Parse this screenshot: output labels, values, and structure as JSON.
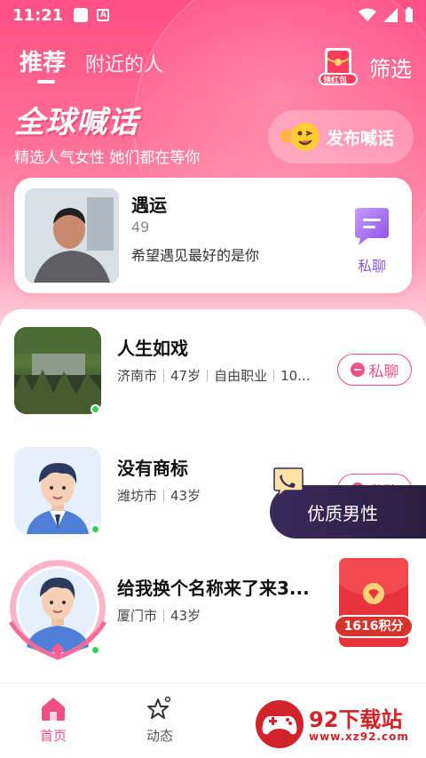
{
  "status_bar": {
    "time": "11:21",
    "app_badge": "A"
  },
  "tabs": [
    {
      "label": "推荐",
      "active": true
    },
    {
      "label": "附近的人",
      "active": false
    }
  ],
  "header": {
    "redpack_label": "领红包",
    "filter_label": "筛选",
    "title": "全球喊话",
    "subtitle": "精选人气女性 她们都在等你",
    "publish_label": "发布喊话"
  },
  "featured": {
    "name": "遇运",
    "age": "49",
    "message": "希望遇见最好的是你",
    "chat_label": "私聊"
  },
  "users": [
    {
      "name": "人生如戏",
      "city": "济南市",
      "age": "47岁",
      "job": "自由职业",
      "extra": "10...",
      "chat_label": "私聊"
    },
    {
      "name": "没有商标",
      "city": "潍坊市",
      "age": "43岁",
      "chat_label": "私聊"
    },
    {
      "name": "给我换个名称来了来3...",
      "city": "厦门市",
      "age": "43岁"
    }
  ],
  "quality_banner": "优质男性",
  "bonus": {
    "label": "1616积分"
  },
  "bottom_nav": [
    {
      "label": "首页",
      "icon": "home-icon",
      "active": true
    },
    {
      "label": "动态",
      "icon": "star-icon",
      "active": false
    }
  ],
  "watermark": {
    "text": "92下载站",
    "url": "www.xz92.com"
  },
  "colors": {
    "brand": "#f14f86",
    "online": "#2fcf5a",
    "purple": "#8b5bd6"
  }
}
